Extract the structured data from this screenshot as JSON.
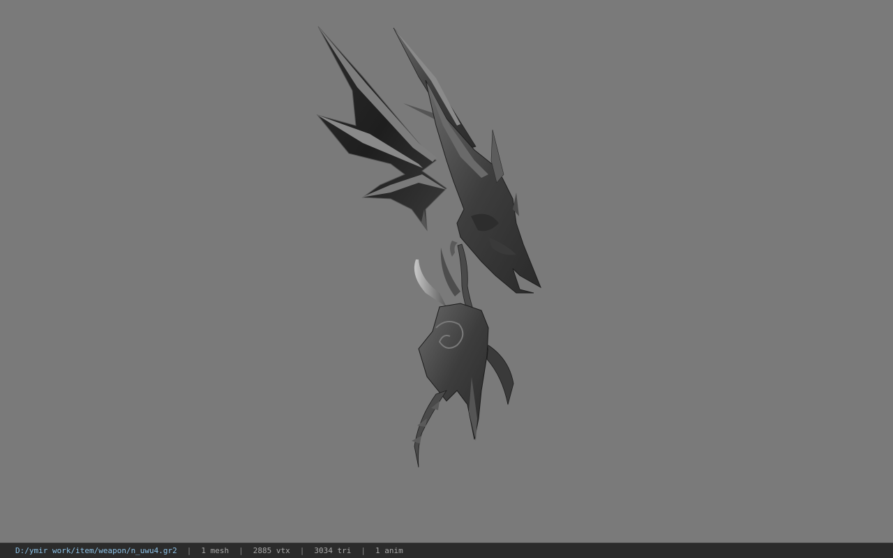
{
  "viewport": {
    "background_color": "#7a7a7a",
    "model_icon": "weapon-model"
  },
  "status": {
    "file_path": "D:/ymir work/item/weapon/n_uwu4.gr2",
    "separator": "|",
    "mesh": "1 mesh",
    "vertices": "2885 vtx",
    "triangles": "3034 tri",
    "animations": "1 anim",
    "path_color": "#8ec3e8"
  }
}
